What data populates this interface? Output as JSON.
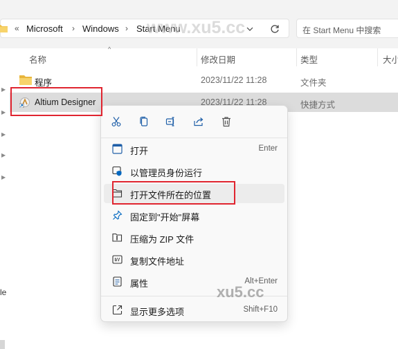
{
  "address_bar": {
    "overflow": "«",
    "crumbs": [
      "Microsoft",
      "Windows",
      "Start Menu"
    ],
    "dropdown_icon": "chevron-down-icon",
    "refresh_icon": "refresh-icon"
  },
  "search": {
    "placeholder": "在 Start Menu 中搜索"
  },
  "columns": {
    "name": "名称",
    "modified": "修改日期",
    "type": "类型",
    "size": "大小"
  },
  "files": [
    {
      "name": "程序",
      "modified": "2023/11/22 11:28",
      "type": "文件夹",
      "icon": "folder-icon"
    },
    {
      "name": "Altium Designer",
      "modified": "2023/11/22 11:28",
      "type": "快捷方式",
      "icon": "altium-shortcut-icon",
      "selected": true
    }
  ],
  "context_menu": {
    "quick_actions": [
      "cut-icon",
      "copy-icon",
      "rename-icon",
      "share-icon",
      "delete-icon"
    ],
    "items": [
      {
        "label": "打开",
        "shortcut": "Enter",
        "icon": "open-icon"
      },
      {
        "label": "以管理员身份运行",
        "shortcut": "",
        "icon": "admin-shield-icon"
      },
      {
        "label": "打开文件所在的位置",
        "shortcut": "",
        "icon": "folder-open-icon",
        "highlighted": true
      },
      {
        "label": "固定到\"开始\"屏幕",
        "shortcut": "",
        "icon": "pin-icon"
      },
      {
        "label": "压缩为 ZIP 文件",
        "shortcut": "",
        "icon": "zip-icon"
      },
      {
        "label": "复制文件地址",
        "shortcut": "",
        "icon": "copy-path-icon"
      },
      {
        "label": "属性",
        "shortcut": "Alt+Enter",
        "icon": "properties-icon"
      },
      {
        "label": "显示更多选项",
        "shortcut": "Shift+F10",
        "icon": "more-options-icon"
      }
    ]
  },
  "watermarks": {
    "top": "www.xu5.cc",
    "bottom": "xu5.cc"
  },
  "left_edge_text": "le",
  "colors": {
    "highlight_box": "#e0242f",
    "selection": "#dcdcdc",
    "accent": "#0067c0"
  }
}
